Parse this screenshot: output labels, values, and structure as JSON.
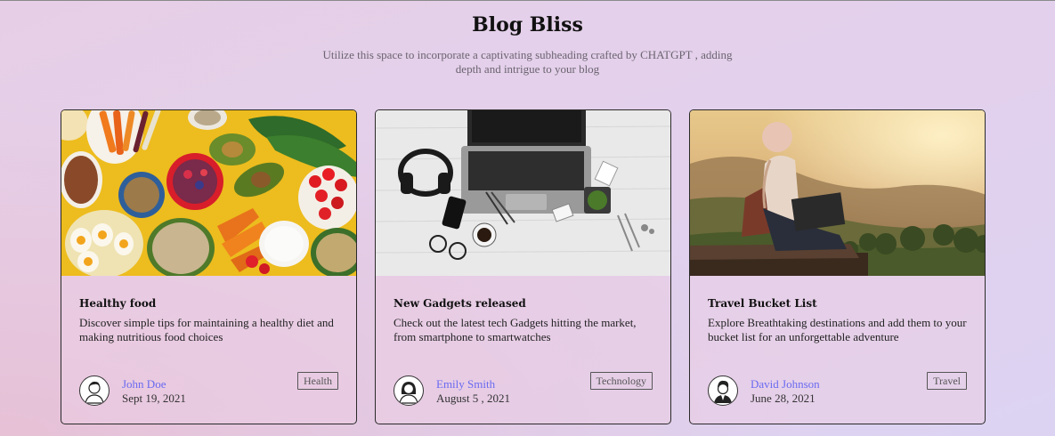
{
  "header": {
    "title": "Blog Bliss",
    "subtitle": "Utilize this space to incorporate a captivating subheading crafted by CHATGPT , adding depth and intrigue to your blog"
  },
  "cards": [
    {
      "image": "healthy-food-photo",
      "title": "Healthy food",
      "description": "Discover simple tips for maintaining a healthy diet and making nutritious food choices",
      "author": "John Doe",
      "date": "Sept 19, 2021",
      "tag": "Health"
    },
    {
      "image": "gadgets-desk-photo",
      "title": "New Gadgets released",
      "description": "Check out the latest tech Gadgets hitting the market, from smartphone to smartwatches",
      "author": "Emily Smith",
      "date": "August 5 , 2021",
      "tag": "Technology"
    },
    {
      "image": "travel-mountain-photo",
      "title": "Travel Bucket List",
      "description": "Explore Breathtaking destinations and add them to your bucket list for an unforgettable adventure",
      "author": "David Johnson",
      "date": "June 28, 2021",
      "tag": "Travel"
    }
  ],
  "colors": {
    "author_link": "#6a6af0",
    "background_start": "#e6cfe6",
    "background_end": "#dcd3f2"
  }
}
